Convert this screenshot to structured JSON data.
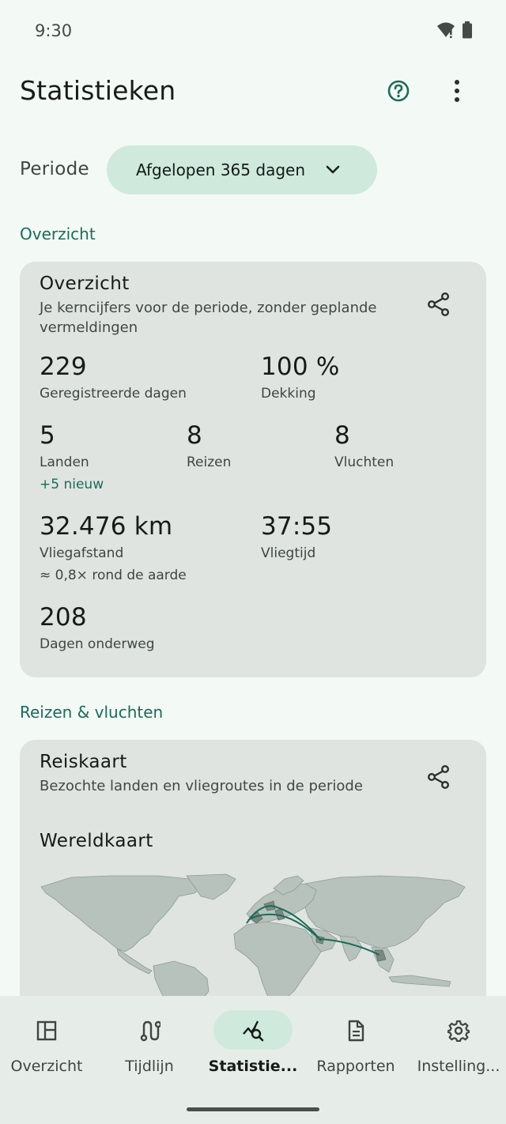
{
  "status_bar": {
    "time": "9:30"
  },
  "app_bar": {
    "title": "Statistieken"
  },
  "period": {
    "label": "Periode",
    "selected": "Afgelopen 365 dagen"
  },
  "sections": {
    "overview_title": "Overzicht",
    "trips_title": "Reizen & vluchten"
  },
  "overview_card": {
    "title": "Overzicht",
    "subtitle": "Je kerncijfers voor de periode, zonder geplande vermeldingen",
    "stats": {
      "registered_days": {
        "value": "229",
        "label": "Geregistreerde dagen"
      },
      "coverage": {
        "value": "100 %",
        "label": "Dekking"
      },
      "countries": {
        "value": "5",
        "label": "Landen",
        "note": "+5 nieuw"
      },
      "trips": {
        "value": "8",
        "label": "Reizen"
      },
      "flights": {
        "value": "8",
        "label": "Vluchten"
      },
      "flight_distance": {
        "value": "32.476 km",
        "label": "Vliegafstand",
        "note": "≈ 0,8× rond de aarde"
      },
      "flight_time": {
        "value": "37:55",
        "label": "Vliegtijd"
      },
      "days_travelling": {
        "value": "208",
        "label": "Dagen onderweg"
      }
    }
  },
  "travel_map_card": {
    "title": "Reiskaart",
    "subtitle": "Bezochte landen en vliegroutes in de periode",
    "map_heading": "Wereldkaart"
  },
  "bottom_nav": {
    "items": [
      {
        "label": "Overzicht",
        "icon": "dashboard-icon",
        "active": false
      },
      {
        "label": "Tijdlijn",
        "icon": "route-icon",
        "active": false
      },
      {
        "label": "Statistie...",
        "icon": "query-stats-icon",
        "active": true
      },
      {
        "label": "Rapporten",
        "icon": "description-icon",
        "active": false
      },
      {
        "label": "Instelling...",
        "icon": "settings-icon",
        "active": false
      }
    ]
  },
  "colors": {
    "background": "#f3f9f5",
    "accent": "#1c6b58",
    "chip": "#cfe9dd",
    "card": "#dfe4e1",
    "route": "#1c6b58"
  }
}
